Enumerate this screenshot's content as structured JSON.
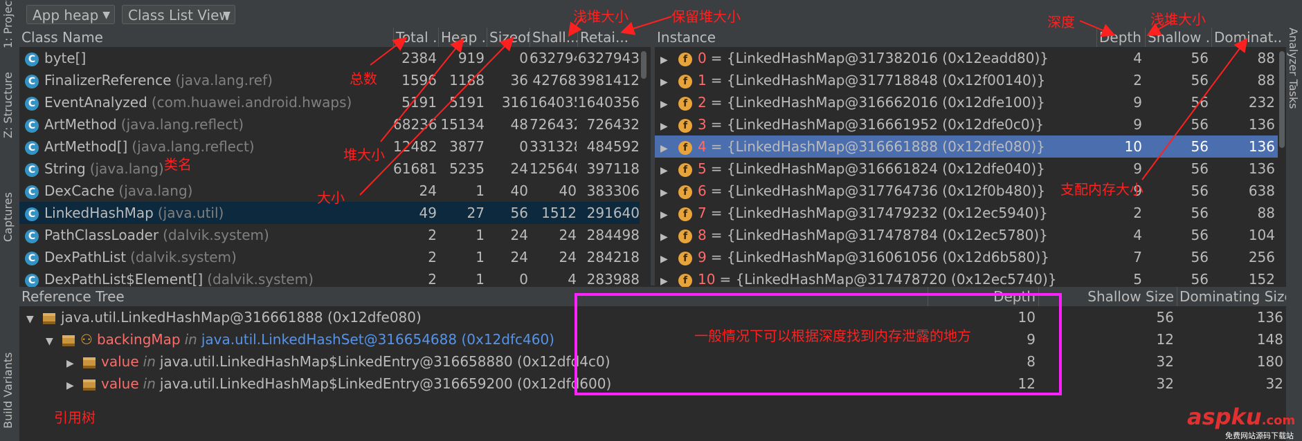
{
  "toolbar": {
    "heap_combo": "App heap",
    "view_combo": "Class List View"
  },
  "left_strip": {
    "tab_project": "1: Project",
    "tab_structure": "Z: Structure",
    "tab_captures": "Captures",
    "tab_build": "Build Variants"
  },
  "right_strip": {
    "tab_analyzer": "Analyzer Tasks"
  },
  "class_table": {
    "headers": [
      "Class Name",
      "Total ...",
      "Heap ...",
      "Sizeof",
      "Shall...",
      "Retai..."
    ],
    "rows": [
      {
        "name": "byte[]",
        "pkg": "",
        "total": "2384",
        "heap": "919",
        "sizeof": "0",
        "shallow": "6327943",
        "retained": "6327943"
      },
      {
        "name": "FinalizerReference",
        "pkg": "(java.lang.ref)",
        "total": "1596",
        "heap": "1188",
        "sizeof": "36",
        "shallow": "42768",
        "retained": "3981412"
      },
      {
        "name": "EventAnalyzed",
        "pkg": "(com.huawei.android.hwaps)",
        "total": "5191",
        "heap": "5191",
        "sizeof": "316",
        "shallow": "1640356",
        "retained": "1640356"
      },
      {
        "name": "ArtMethod",
        "pkg": "(java.lang.reflect)",
        "total": "68236",
        "heap": "15134",
        "sizeof": "48",
        "shallow": "726432",
        "retained": "726432"
      },
      {
        "name": "ArtMethod[]",
        "pkg": "(java.lang.reflect)",
        "total": "12482",
        "heap": "3877",
        "sizeof": "0",
        "shallow": "331328",
        "retained": "484592"
      },
      {
        "name": "String",
        "pkg": "(java.lang)",
        "total": "61681",
        "heap": "5235",
        "sizeof": "24",
        "shallow": "125640",
        "retained": "397118"
      },
      {
        "name": "DexCache",
        "pkg": "(java.lang)",
        "total": "24",
        "heap": "1",
        "sizeof": "40",
        "shallow": "40",
        "retained": "383306"
      },
      {
        "name": "LinkedHashMap",
        "pkg": "(java.util)",
        "total": "49",
        "heap": "27",
        "sizeof": "56",
        "shallow": "1512",
        "retained": "291640"
      },
      {
        "name": "PathClassLoader",
        "pkg": "(dalvik.system)",
        "total": "2",
        "heap": "1",
        "sizeof": "24",
        "shallow": "24",
        "retained": "284498"
      },
      {
        "name": "DexPathList",
        "pkg": "(dalvik.system)",
        "total": "2",
        "heap": "1",
        "sizeof": "24",
        "shallow": "24",
        "retained": "284218"
      },
      {
        "name": "DexPathList$Element[]",
        "pkg": "(dalvik.system)",
        "total": "2",
        "heap": "1",
        "sizeof": "0",
        "shallow": "4",
        "retained": "283988"
      }
    ]
  },
  "instance_table": {
    "headers": [
      "Instance",
      "Depth",
      "Shallow ...",
      "Dominat..."
    ],
    "rows": [
      {
        "idx": "0",
        "text": "= {LinkedHashMap@317382016 (0x12eadd80)}",
        "depth": "4",
        "shallow": "56",
        "dom": "88"
      },
      {
        "idx": "1",
        "text": "= {LinkedHashMap@317718848 (0x12f00140)}",
        "depth": "2",
        "shallow": "56",
        "dom": "88"
      },
      {
        "idx": "2",
        "text": "= {LinkedHashMap@316662016 (0x12dfe100)}",
        "depth": "9",
        "shallow": "56",
        "dom": "232"
      },
      {
        "idx": "3",
        "text": "= {LinkedHashMap@316661952 (0x12dfe0c0)}",
        "depth": "9",
        "shallow": "56",
        "dom": "136"
      },
      {
        "idx": "4",
        "text": "= {LinkedHashMap@316661888 (0x12dfe080)}",
        "depth": "10",
        "shallow": "56",
        "dom": "136"
      },
      {
        "idx": "5",
        "text": "= {LinkedHashMap@316661824 (0x12dfe040)}",
        "depth": "9",
        "shallow": "56",
        "dom": "136"
      },
      {
        "idx": "6",
        "text": "= {LinkedHashMap@317764736 (0x12f0b480)}",
        "depth": "9",
        "shallow": "56",
        "dom": "638"
      },
      {
        "idx": "7",
        "text": "= {LinkedHashMap@317479232 (0x12ec5940)}",
        "depth": "2",
        "shallow": "56",
        "dom": "88"
      },
      {
        "idx": "8",
        "text": "= {LinkedHashMap@317478784 (0x12ec5780)}",
        "depth": "4",
        "shallow": "56",
        "dom": "104"
      },
      {
        "idx": "9",
        "text": "= {LinkedHashMap@316061056 (0x12d6b580)}",
        "depth": "7",
        "shallow": "56",
        "dom": "256"
      },
      {
        "idx": "10",
        "text": "= {LinkedHashMap@317478720 (0x12ec5740)}",
        "depth": "5",
        "shallow": "56",
        "dom": "152"
      }
    ]
  },
  "ref_tree": {
    "headers": [
      "Reference Tree",
      "Depth",
      "Shallow Size",
      "Dominating Size"
    ],
    "rows": [
      {
        "prefix": "",
        "name": "java.util.LinkedHashMap@316661888 (0x12dfe080)",
        "in": "",
        "target": "",
        "depth": "10",
        "shallow": "56",
        "dom": "136"
      },
      {
        "prefix": "backingMap",
        "name": "",
        "in": "in",
        "target": "java.util.LinkedHashSet@316654688 (0x12dfc460)",
        "depth": "9",
        "shallow": "12",
        "dom": "148"
      },
      {
        "prefix": "value",
        "name": "",
        "in": "in",
        "target": "java.util.LinkedHashMap$LinkedEntry@316658880 (0x12dfd4c0)",
        "depth": "8",
        "shallow": "32",
        "dom": "180"
      },
      {
        "prefix": "value",
        "name": "",
        "in": "in",
        "target": "java.util.LinkedHashMap$LinkedEntry@316659200 (0x12dfd600)",
        "depth": "12",
        "shallow": "32",
        "dom": "32"
      }
    ]
  },
  "annotations": {
    "shallow_top": "浅堆大小",
    "retained_top": "保留堆大小",
    "depth_ann": "深度",
    "shallow_right": "浅堆大小",
    "total_ann": "总数",
    "heap_ann": "堆大小",
    "classname_ann": "类名",
    "size_ann": "大小",
    "dominating_ann": "支配内存大小",
    "leak_note": "一般情况下可以根据深度找到内存泄露的地方",
    "reftree_ann": "引用树"
  },
  "watermark": {
    "brand": "aspku",
    "suffix": ".com",
    "sub": "免费网站源码下载站"
  },
  "colors": {
    "background": "#2b2b2b",
    "panel": "#3c3f41",
    "selection": "#4b6eaf",
    "annotation": "#ff2020",
    "box": "#ff22ff"
  }
}
